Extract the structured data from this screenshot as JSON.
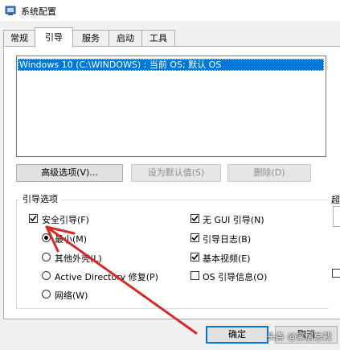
{
  "window": {
    "title": "系统配置",
    "icon": "system-config-icon"
  },
  "tabs": [
    {
      "label": "常规",
      "active": false
    },
    {
      "label": "引导",
      "active": true
    },
    {
      "label": "服务",
      "active": false
    },
    {
      "label": "启动",
      "active": false
    },
    {
      "label": "工具",
      "active": false
    }
  ],
  "os_list": {
    "items": [
      "Windows 10 (C:\\WINDOWS) : 当前 OS; 默认 OS"
    ],
    "selected_index": 0
  },
  "buttons": {
    "advanced": "高级选项(V)...",
    "set_default": "设为默认值(S)",
    "delete": "删除(D)",
    "ok": "确定",
    "cancel": "取消"
  },
  "boot_options": {
    "title": "引导选项",
    "safe_boot": {
      "label": "安全引导(F)",
      "checked": true
    },
    "minimal": {
      "label": "最小(M)",
      "selected": true
    },
    "alternate_shell": {
      "label": "其他外壳(L)",
      "selected": false
    },
    "ad_repair": {
      "label": "Active Directory 修复(P)",
      "selected": false
    },
    "network": {
      "label": "网络(W)",
      "selected": false
    },
    "no_gui": {
      "label": "无 GUI 引导(N)",
      "checked": true
    },
    "boot_log": {
      "label": "引导日志(B)",
      "checked": true
    },
    "base_video": {
      "label": "基本视频(E)",
      "checked": true
    },
    "os_boot_info": {
      "label": "OS 引导信息(O)",
      "checked": false
    }
  },
  "side": {
    "label": "超"
  },
  "annotation": {
    "arrow_color": "#d42a2a"
  },
  "watermark": "头条 @家居总裁",
  "colors": {
    "selection": "#0078d7",
    "ok_border": "#0078d7"
  }
}
